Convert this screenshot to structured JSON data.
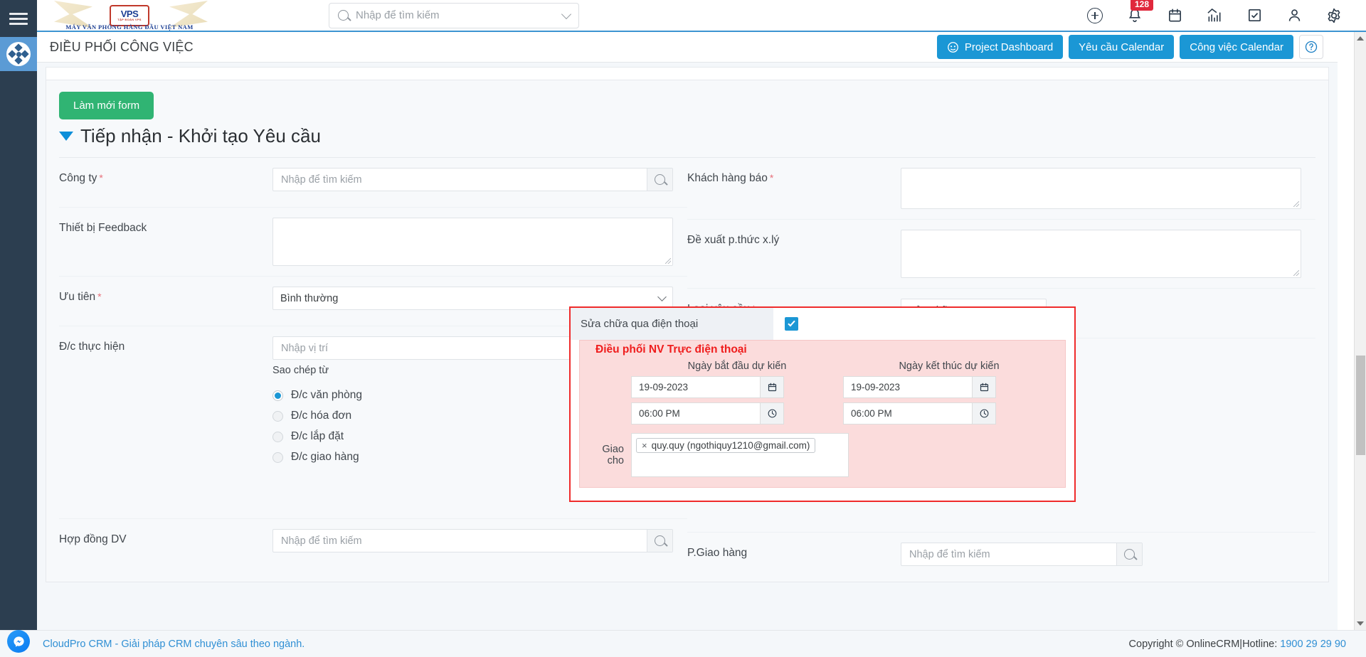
{
  "sidebar": {
    "menu_icon": "hamburger-icon",
    "active_item_icon": "workflow-icon",
    "messenger_icon": "messenger-icon"
  },
  "header": {
    "brand_name": "VPS",
    "brand_group": "TẬP ĐOÀN VPS",
    "brand_tagline": "MÁY VĂN PHÒNG HÀNG ĐẦU VIỆT NAM",
    "search_placeholder": "Nhập để tìm kiếm",
    "icons": [
      {
        "name": "add-icon",
        "label": "+"
      },
      {
        "name": "notification-bell-icon",
        "label": ""
      },
      {
        "name": "calendar-icon",
        "label": ""
      },
      {
        "name": "analytics-chart-icon",
        "label": ""
      },
      {
        "name": "task-checkbox-icon",
        "label": ""
      },
      {
        "name": "user-account-icon",
        "label": ""
      },
      {
        "name": "settings-gear-icon",
        "label": ""
      }
    ],
    "notification_count": "128"
  },
  "titlebar": {
    "page_title": "ĐIỀU PHỐI CÔNG VIỆC",
    "buttons": [
      {
        "label": "Project Dashboard",
        "icon": "dashboard-icon"
      },
      {
        "label": "Yêu cầu Calendar",
        "icon": ""
      },
      {
        "label": "Công việc Calendar",
        "icon": ""
      }
    ],
    "help_label": "?"
  },
  "form": {
    "refresh_button": "Làm mới form",
    "title": "Tiếp nhận - Khởi tạo Yêu cầu",
    "left_fields": {
      "company_label": "Công ty",
      "company_required": "*",
      "company_placeholder": "Nhập để tìm kiếm",
      "device_feedback_label": "Thiết bị Feedback",
      "device_feedback_value": "",
      "priority_label": "Ưu tiên",
      "priority_required": "*",
      "priority_value": "Bình thường",
      "address_label": "Đ/c thực hiện",
      "address_placeholder": "Nhập vị trí",
      "copy_from_label": "Sao chép từ",
      "radio_options": [
        {
          "label": "Đ/c văn phòng",
          "selected": true
        },
        {
          "label": "Đ/c hóa đơn",
          "selected": false
        },
        {
          "label": "Đ/c lắp đặt",
          "selected": false
        },
        {
          "label": "Đ/c giao hàng",
          "selected": false
        }
      ],
      "contract_label": "Hợp đồng DV",
      "contract_placeholder": "Nhập để tìm kiếm"
    },
    "right_fields": {
      "customer_report_label": "Khách hàng báo",
      "customer_report_required": "*",
      "customer_report_value": "",
      "proposal_label": "Đề xuất p.thức x.lý",
      "proposal_value": "",
      "request_type_label": "Loại yêu cầu",
      "request_type_required": "*",
      "request_type_value": "Sửa chữa",
      "delivery_label": "P.Giao hàng",
      "delivery_placeholder": "Nhập để tìm kiếm"
    },
    "highlight_panel": {
      "phone_repair_label": "Sửa chữa qua điện thoại",
      "phone_repair_checked": true,
      "legend": "Điều phối NV Trực điện thoại",
      "start_date_header": "Ngày bắt đầu dự kiến",
      "end_date_header": "Ngày kết thúc dự kiến",
      "start_date_value": "19-09-2023",
      "start_time_value": "06:00 PM",
      "end_date_value": "19-09-2023",
      "end_time_value": "06:00 PM",
      "assign_label": "Giao cho",
      "assign_tags": [
        {
          "remove": "×",
          "text": "quy.quy (ngothiquy1210@gmail.com)"
        }
      ],
      "calendar_icon": "calendar-icon",
      "clock_icon": "clock-icon"
    }
  },
  "footer": {
    "left_text": "CloudPro CRM - Giải pháp CRM chuyên sâu theo ngành.",
    "copyright": "Copyright © OnlineCRM",
    "separator": "|",
    "hotline_label": "Hotline:",
    "hotline_number": "1900 29 29 90"
  },
  "colors": {
    "sidebar_bg": "#2c3e50",
    "accent_blue": "#1b97d5",
    "refresh_green": "#30b473",
    "highlight_red": "#ef2b2b",
    "pink_bg": "#fbdcdc",
    "badge_red": "#e0283c"
  }
}
